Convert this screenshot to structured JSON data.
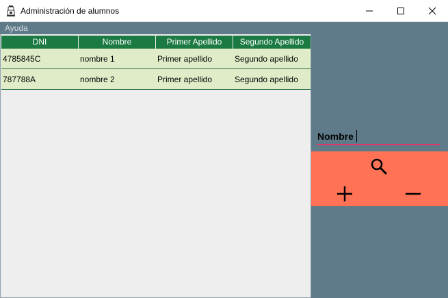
{
  "window": {
    "title": "Administración de alumnos",
    "icon": "app-icon",
    "controls": [
      "minimize-icon",
      "maximize-icon",
      "close-icon"
    ]
  },
  "menu": {
    "items": [
      "Ayuda"
    ]
  },
  "table": {
    "columns": [
      "DNI",
      "Nombre",
      "Primer Apellido",
      "Segundo Apellido"
    ],
    "rows": [
      [
        "4785845C",
        "nombre 1",
        "Primer apellido",
        "Segundo apellido"
      ],
      [
        "787788A",
        "nombre 2",
        "Primer apellido",
        "Segundo apellido"
      ]
    ]
  },
  "search": {
    "field_value": "Nombre"
  },
  "actions": {
    "search_icon": "search-icon",
    "add_icon": "plus-icon",
    "remove_icon": "minus-icon"
  },
  "colors": {
    "header_green": "#1a7a42",
    "row_bg": "#e0ecc8",
    "panel_bg": "#5f7b8a",
    "accent_underline": "#e4346b",
    "action_bg": "#ff7256"
  }
}
